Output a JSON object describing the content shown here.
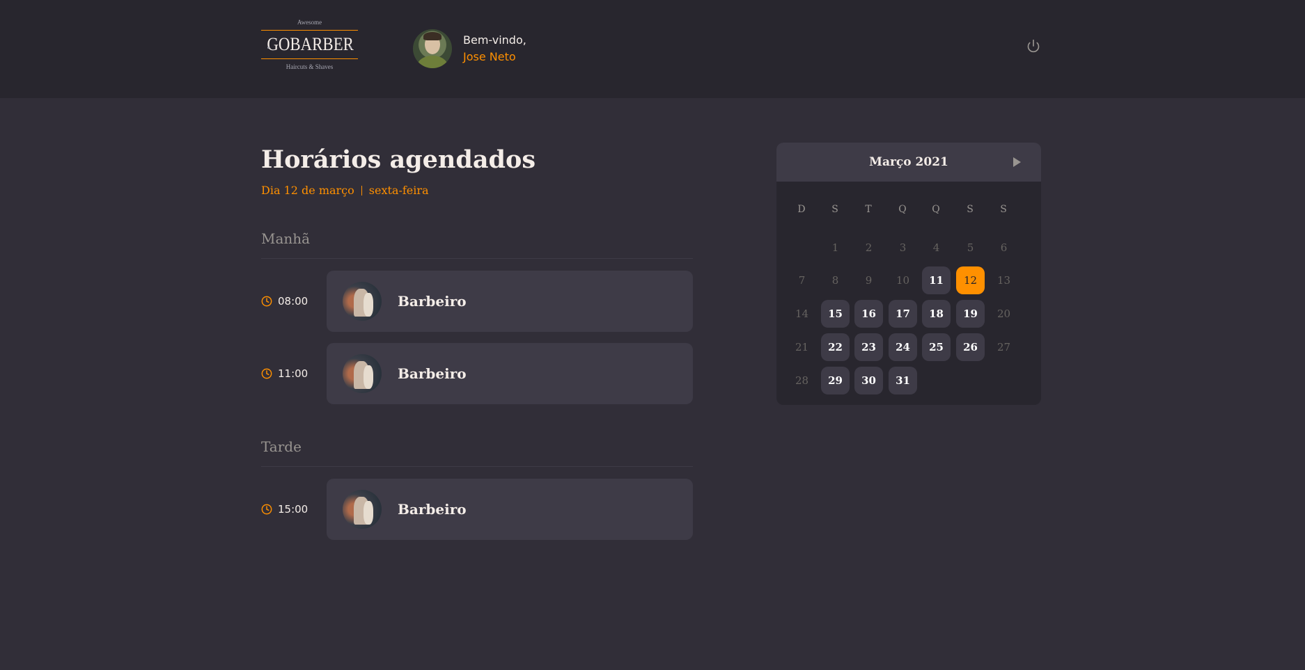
{
  "header": {
    "logo": {
      "top": "Awesome",
      "main": "GOBARBER",
      "bottom": "Haircuts & Shaves"
    },
    "welcome": "Bem-vindo,",
    "username": "Jose Neto",
    "power_icon": "power-icon"
  },
  "schedule": {
    "title": "Horários agendados",
    "day": "Dia 12 de março",
    "weekday": "sexta-feira"
  },
  "morning": {
    "title": "Manhã",
    "appointments": [
      {
        "time": "08:00",
        "provider": "Barbeiro"
      },
      {
        "time": "11:00",
        "provider": "Barbeiro"
      }
    ]
  },
  "afternoon": {
    "title": "Tarde",
    "appointments": [
      {
        "time": "15:00",
        "provider": "Barbeiro"
      }
    ]
  },
  "calendar": {
    "month": "Março 2021",
    "weekdays": [
      "D",
      "S",
      "T",
      "Q",
      "Q",
      "S",
      "S"
    ],
    "weeks": [
      [
        null,
        "1",
        "2",
        "3",
        "4",
        "5",
        "6"
      ],
      [
        "7",
        "8",
        "9",
        "10",
        "11",
        "12",
        "13"
      ],
      [
        "14",
        "15",
        "16",
        "17",
        "18",
        "19",
        "20"
      ],
      [
        "21",
        "22",
        "23",
        "24",
        "25",
        "26",
        "27"
      ],
      [
        "28",
        "29",
        "30",
        "31",
        null,
        null,
        null
      ]
    ],
    "available_days": [
      "11",
      "15",
      "16",
      "17",
      "18",
      "19",
      "22",
      "23",
      "24",
      "25",
      "26",
      "29",
      "30",
      "31"
    ],
    "selected_day": "12",
    "accent": "#ff9000"
  }
}
